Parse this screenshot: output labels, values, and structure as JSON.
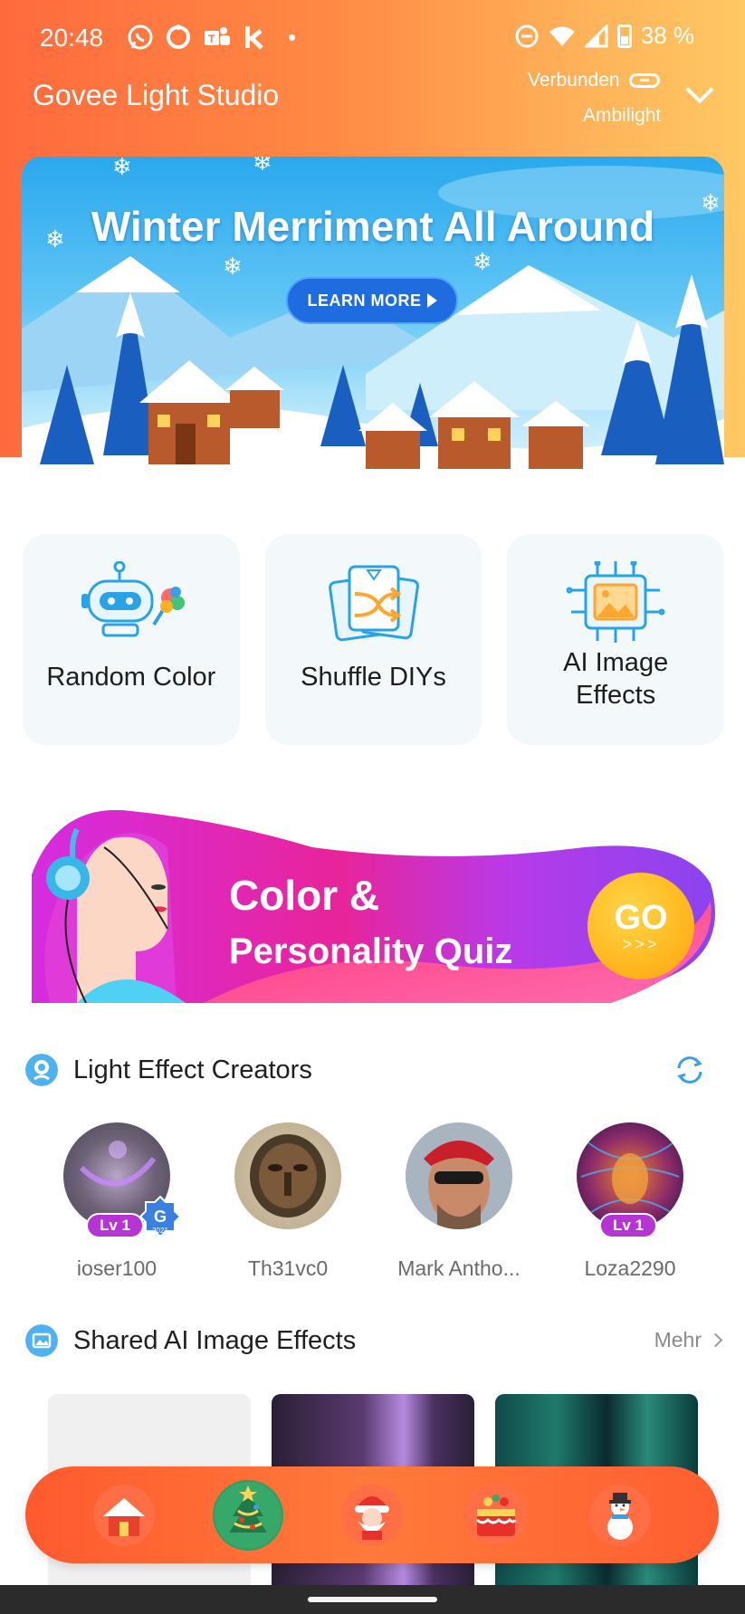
{
  "status_bar": {
    "time": "20:48",
    "battery": "38 %",
    "apps": [
      "whatsapp-icon",
      "ring-app-icon",
      "teams-icon",
      "k-app-icon"
    ]
  },
  "header": {
    "title": "Govee Light Studio",
    "connection_status": "Verbunden",
    "device_name": "Ambilight"
  },
  "banner": {
    "title": "Winter Merriment All Around",
    "button_label": "LEARN MORE"
  },
  "features": [
    {
      "label": "Random Color",
      "icon": "robot-palette-icon"
    },
    {
      "label": "Shuffle DIYs",
      "icon": "shuffle-cards-icon"
    },
    {
      "label": "AI Image Effects",
      "icon": "ai-chip-image-icon"
    }
  ],
  "quiz": {
    "title_line1": "Color &",
    "title_line2": "Personality Quiz",
    "go_label": "GO",
    "go_arrows": ">>>"
  },
  "creators_section": {
    "title": "Light Effect Creators",
    "creators": [
      {
        "name": "ioser100",
        "level": "Lv 1",
        "badge": "2021"
      },
      {
        "name": "Th31vc0",
        "level": "",
        "badge": ""
      },
      {
        "name": "Mark Antho...",
        "level": "",
        "badge": ""
      },
      {
        "name": "Loza2290",
        "level": "Lv 1",
        "badge": ""
      }
    ]
  },
  "shared_section": {
    "title": "Shared AI Image Effects",
    "more_label": "Mehr"
  },
  "bottom_nav": [
    "home-house-icon",
    "christmas-tree-icon",
    "santa-icon",
    "gift-cake-icon",
    "snowman-icon"
  ],
  "colors": {
    "header_gradient_start": "#ff6a3d",
    "header_gradient_end": "#ffc863",
    "accent_blue": "#3aa0e6",
    "level_badge": "#b634d4",
    "nav_orange": "#ff5a2e"
  }
}
